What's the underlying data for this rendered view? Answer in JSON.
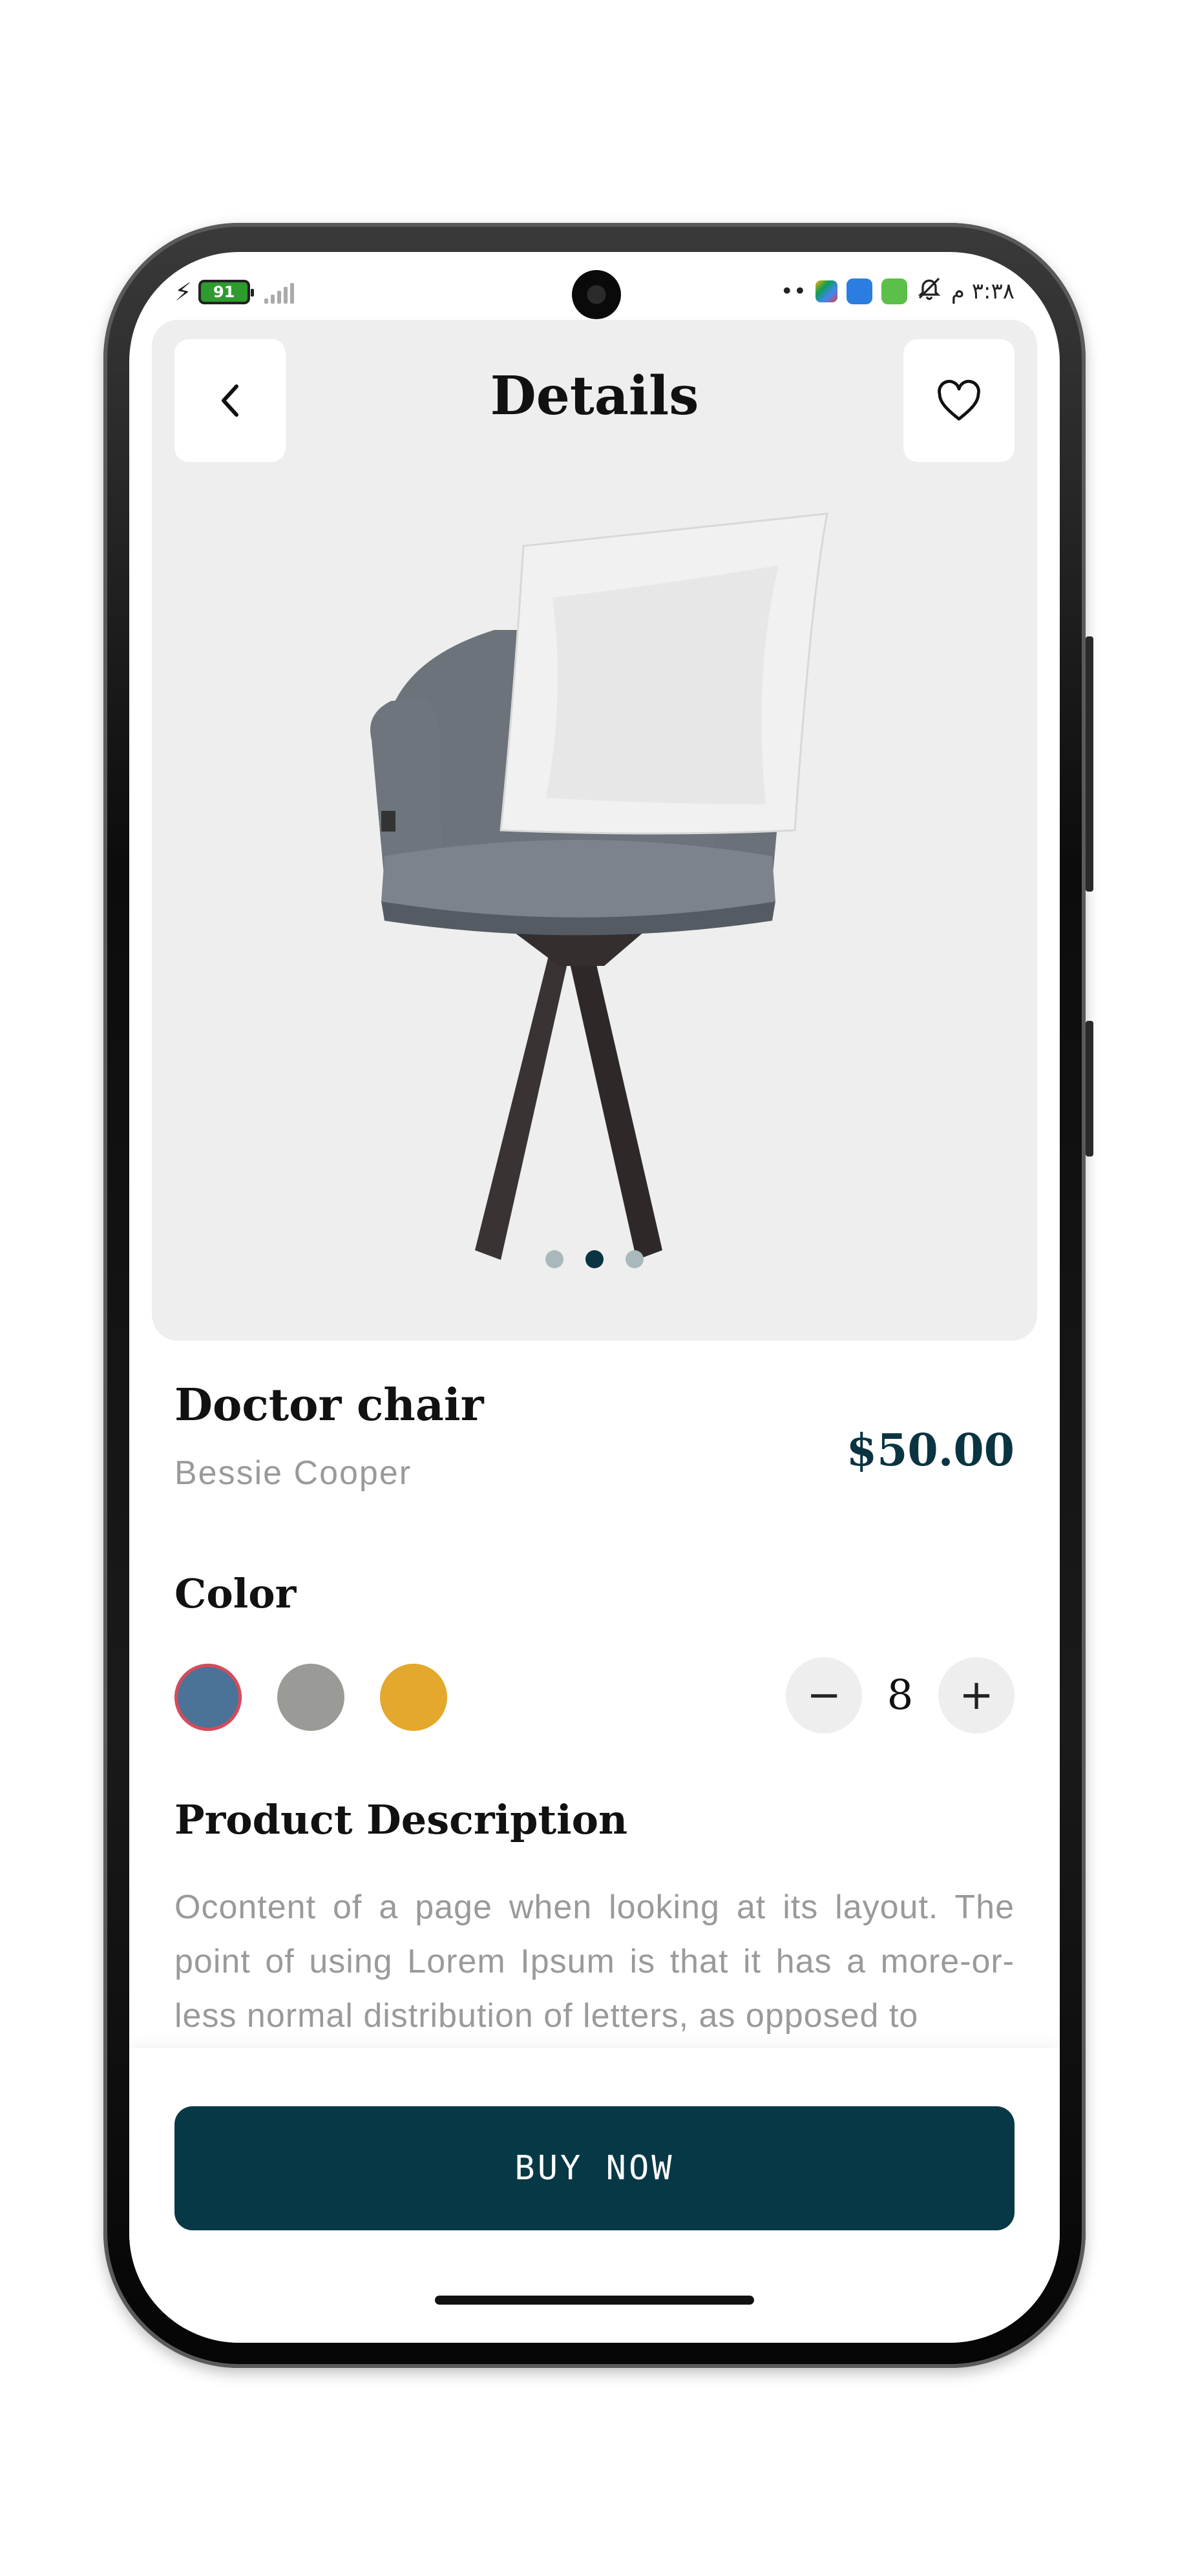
{
  "status_bar": {
    "battery": "91",
    "time": "٣:٣٨ م",
    "overflow_dots": "••"
  },
  "header": {
    "title": "Details"
  },
  "carousel": {
    "dot_count": 3,
    "active_index": 1
  },
  "product": {
    "name": "Doctor chair",
    "seller": "Bessie Cooper",
    "price": "$50.00"
  },
  "color_section": {
    "label": "Color",
    "options": [
      "#4a7397",
      "#9a9b96",
      "#e3a82c"
    ],
    "selected_index": 0
  },
  "quantity": {
    "minus": "−",
    "value": "8",
    "plus": "+"
  },
  "description": {
    "title": "Product Description",
    "text": "Ocontent of a page when looking at its layout. The point of using Lorem Ipsum is that it has a more-or-less normal distribution of letters, as opposed to"
  },
  "cta": {
    "label": "BUY NOW"
  },
  "colors": {
    "accent": "#073846",
    "hero_background": "#eeeeee",
    "selected_ring": "#d84a5a"
  }
}
